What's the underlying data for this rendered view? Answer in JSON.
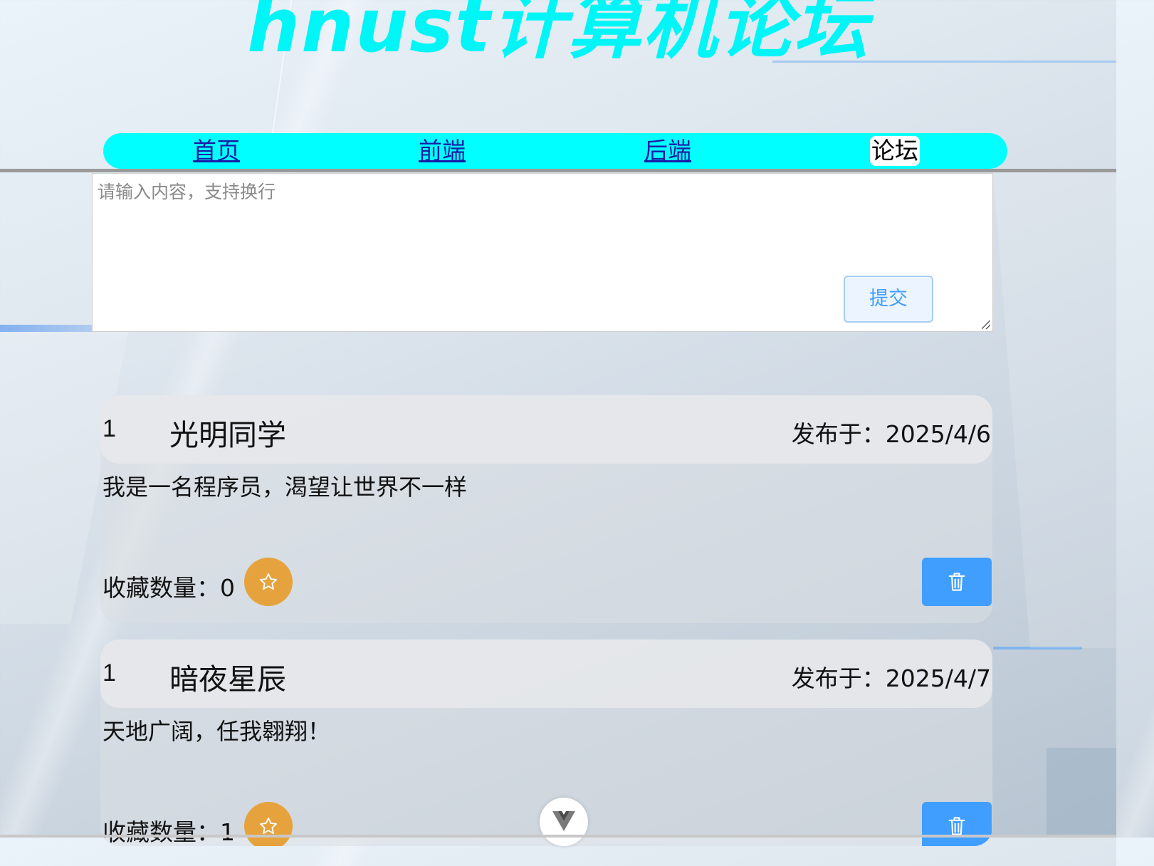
{
  "site": {
    "title": "hnust计算机论坛",
    "title_color": "#00f6f6"
  },
  "nav": {
    "items": [
      {
        "label": "首页",
        "active": false
      },
      {
        "label": "前端",
        "active": false
      },
      {
        "label": "后端",
        "active": false
      },
      {
        "label": "论坛",
        "active": true
      }
    ],
    "bar_color": "#00ffff"
  },
  "composer": {
    "placeholder": "请输入内容，支持换行",
    "value": "",
    "submit_label": "提交"
  },
  "posts": [
    {
      "index": "1",
      "author": "光明同学",
      "date": "发布于：2025/4/6",
      "content": "我是一名程序员，渴望让世界不一样",
      "favorites": "收藏数量：0",
      "fav_icon": "star-icon",
      "delete_icon": "trash-icon"
    },
    {
      "index": "1",
      "author": "暗夜星辰",
      "date": "发布于：2025/4/7",
      "content": "天地广阔，任我翱翔！",
      "favorites": "收藏数量：1",
      "fav_icon": "star-icon",
      "delete_icon": "trash-icon"
    }
  ],
  "colors": {
    "favorite_button": "#e6a23c",
    "delete_button": "#409eff",
    "submit_text": "#409eff"
  },
  "float_button": {
    "icon": "vue-logo-icon"
  }
}
